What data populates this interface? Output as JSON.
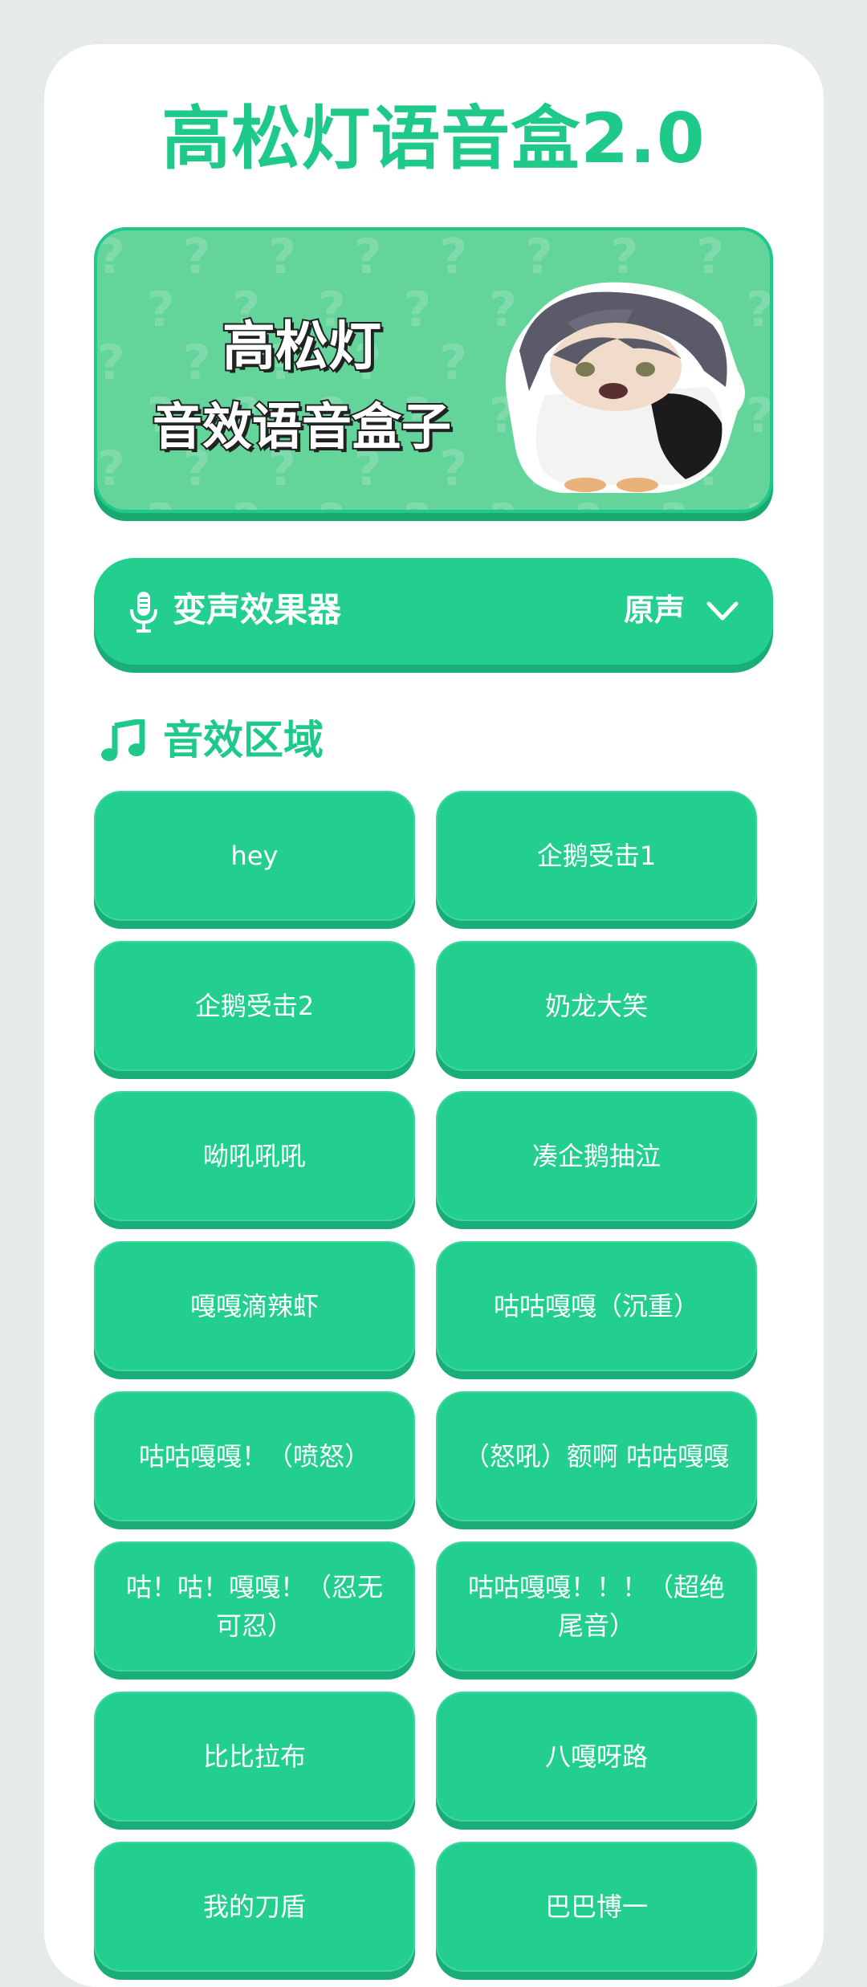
{
  "app": {
    "title": "高松灯语音盒2.0"
  },
  "banner": {
    "line1": "高松灯",
    "line2": "音效语音盒子",
    "pattern_glyph": "?"
  },
  "voice_changer": {
    "label": "变声效果器",
    "selected_value": "原声",
    "icon": "microphone-icon",
    "dropdown_icon": "chevron-down-icon"
  },
  "sound_section": {
    "title": "音效区域",
    "icon": "music-note-icon"
  },
  "sounds": [
    "hey",
    "企鹅受击1",
    "企鹅受击2",
    "奶龙大笑",
    "呦吼吼吼",
    "凑企鹅抽泣",
    "嘎嘎滴辣虾",
    "咕咕嘎嘎（沉重）",
    "咕咕嘎嘎！（喷怒）",
    "（怒吼）额啊 咕咕嘎嘎",
    "咕！咕！嘎嘎！（忍无可忍）",
    "咕咕嘎嘎！！！（超绝尾音）",
    "比比拉布",
    "八嘎呀路",
    "我的刀盾",
    "巴巴博一"
  ],
  "colors": {
    "accent": "#1fc98a",
    "button": "#22cf8f",
    "button_shadow": "#19ad77",
    "banner_bg": "#63d49a",
    "page_bg": "#e6eae9"
  }
}
